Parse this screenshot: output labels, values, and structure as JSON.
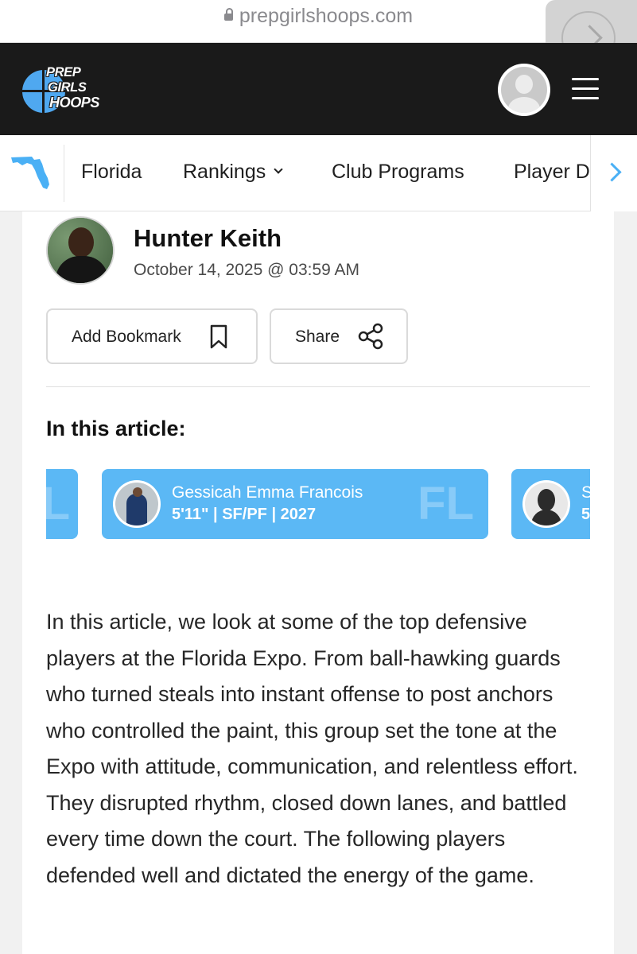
{
  "browser": {
    "url": "prepgirlshoops.com"
  },
  "header": {
    "logo_lines": [
      "PREP",
      "GIRLS",
      "HOOPS"
    ],
    "brand_color": "#4fa8f0"
  },
  "state_nav": {
    "state_icon": "florida-map-icon",
    "items": [
      {
        "label": "Florida"
      },
      {
        "label": "Rankings",
        "has_dropdown": true
      },
      {
        "label": "Club Programs"
      },
      {
        "label": "Player D"
      }
    ],
    "accent_color": "#4ab0f5"
  },
  "article": {
    "author": "Hunter Keith",
    "date": "October 14, 2025 @ 03:59 AM",
    "bookmark_label": "Add Bookmark",
    "share_label": "Share",
    "in_article_heading": "In this article:",
    "players": [
      {
        "name": "",
        "info": "",
        "state": "FL"
      },
      {
        "name": "Gessicah Emma Francois",
        "info": "5'11\" | SF/PF | 2027",
        "state": "FL"
      },
      {
        "name": "S",
        "info": "5",
        "state": ""
      }
    ],
    "card_color": "#5bb8f5",
    "body": "In this article, we look at some of the top defensive players at the Florida Expo. From ball-hawking guards who turned steals into instant offense to post anchors who controlled the paint, this group set the tone at the Expo with attitude, communication, and relentless effort. They disrupted rhythm, closed down lanes, and battled every time down the court. The following players defended well and dictated the energy of the game."
  }
}
